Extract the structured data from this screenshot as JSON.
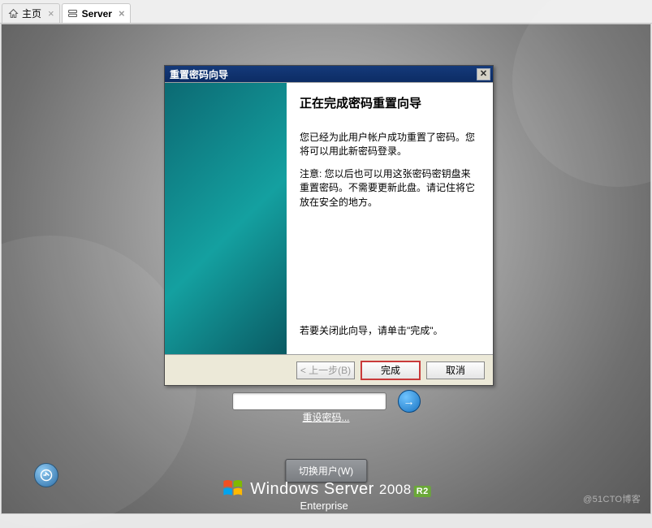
{
  "tabs": {
    "home": "主页",
    "server": "Server"
  },
  "wizard": {
    "title": "重置密码向导",
    "heading": "正在完成密码重置向导",
    "body1": "您已经为此用户帐户成功重置了密码。您将可以用此新密码登录。",
    "body2": "注意:  您以后也可以用这张密码密钥盘来重置密码。不需要更新此盘。请记住将它放在安全的地方。",
    "body3": "若要关闭此向导，请单击\"完成\"。",
    "back": "< 上一步(B)",
    "finish": "完成",
    "cancel": "取消"
  },
  "login": {
    "reset_link": "重设密码...",
    "switch_user": "切换用户(W)",
    "go_icon": "→"
  },
  "brand": {
    "line_part1": "Windows Server",
    "year": "2008",
    "r2": "R2",
    "edition": "Enterprise"
  },
  "watermark": "@51CTO博客"
}
